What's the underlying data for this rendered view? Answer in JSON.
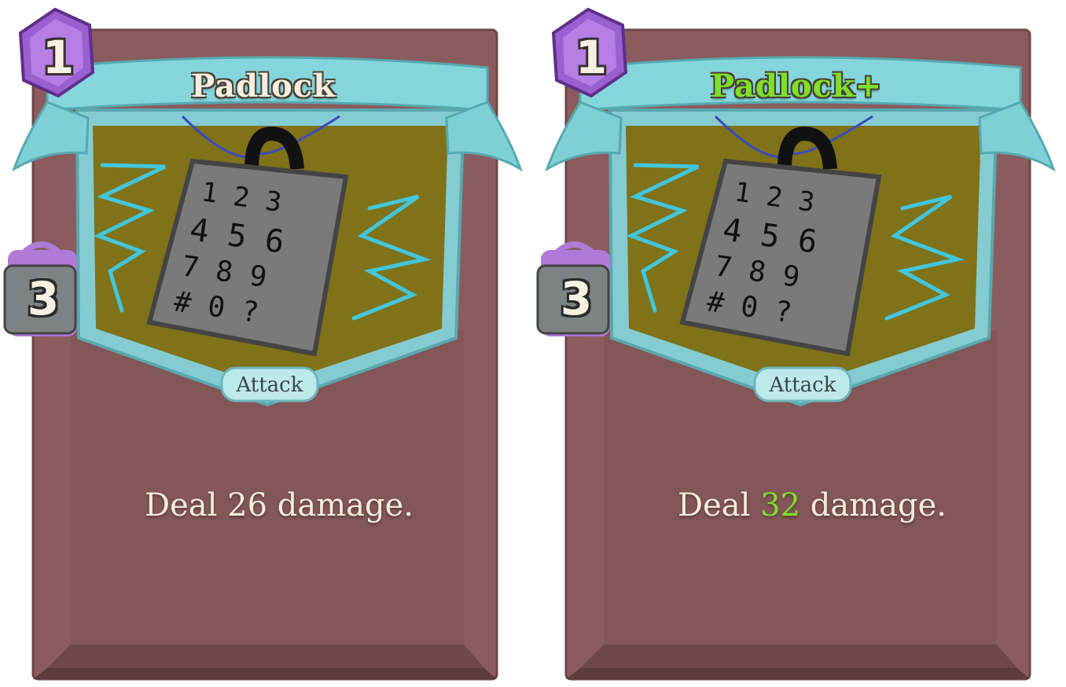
{
  "colors": {
    "card_frame": "#8a5a5c",
    "card_body": "#875e60",
    "banner": "#7ed6dc",
    "art_bg": "#7f7219",
    "cost_gem": "#9a5fd0",
    "upgraded_text": "#7ee02a",
    "text_light": "#f4ecdc"
  },
  "cards": [
    {
      "title": "Padlock",
      "upgraded": false,
      "cost": "1",
      "lock_value": "3",
      "type": "Attack",
      "desc_prefix": "Deal ",
      "damage": "26",
      "desc_suffix": " damage.",
      "art_keypad": {
        "row1": "1 2 3",
        "row2": "4 5 6",
        "row3": "7 8 9",
        "row4": "# 0 ?"
      }
    },
    {
      "title": "Padlock+",
      "upgraded": true,
      "cost": "1",
      "lock_value": "3",
      "type": "Attack",
      "desc_prefix": "Deal ",
      "damage": "32",
      "desc_suffix": " damage.",
      "art_keypad": {
        "row1": "1 2 3",
        "row2": "4 5 6",
        "row3": "7 8 9",
        "row4": "# 0 ?"
      }
    }
  ],
  "icons": {
    "cost": "energy-gem-icon",
    "lock": "padlock-icon",
    "art": "keypad-padlock-illustration"
  }
}
